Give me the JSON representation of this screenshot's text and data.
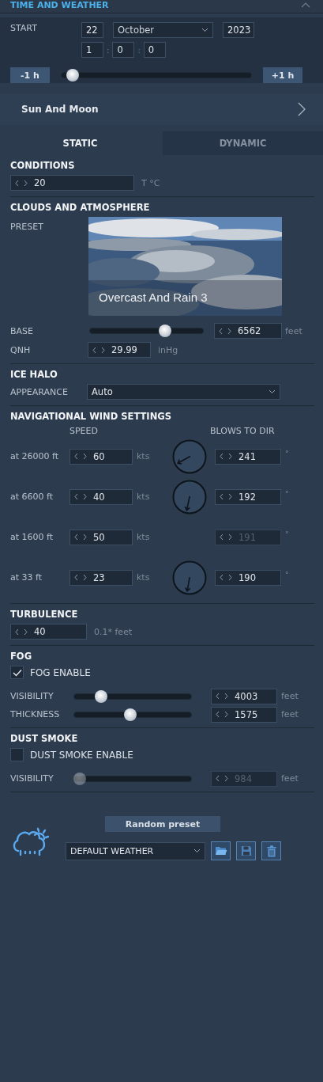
{
  "window": {
    "title": "TIME AND WEATHER"
  },
  "start": {
    "label": "START",
    "day": "22",
    "month": "October",
    "year": "2023",
    "hour": "1",
    "minute": "0",
    "second": "0",
    "separator": ":"
  },
  "time_slider": {
    "minus": "-1 h",
    "plus": "+1 h",
    "level": 0.03
  },
  "sun_and_moon": {
    "label": "Sun And Moon"
  },
  "tabs": [
    {
      "label": "STATIC",
      "selected": true
    },
    {
      "label": "DYNAMIC",
      "selected": false
    }
  ],
  "conditions": {
    "title": "CONDITIONS",
    "temperature": "20",
    "unit": "T °C"
  },
  "clouds": {
    "title": "CLOUDS AND ATMOSPHERE",
    "preset_label": "PRESET",
    "preset": {
      "kind": "picture",
      "caption": "Overcast And Rain 3"
    },
    "base": {
      "label": "BASE",
      "level": 0.68,
      "value": "6562",
      "unit": "feet"
    },
    "qnh": {
      "label": "QNH",
      "value": "29.99",
      "unit": "inHg"
    }
  },
  "ice_halo": {
    "title": "ICE HALO",
    "label": "APPEARANCE",
    "value": "Auto"
  },
  "wind": {
    "title": "NAVIGATIONAL WIND SETTINGS",
    "speed_header": "SPEED",
    "dir_header": "BLOWS TO DIR",
    "rows": [
      {
        "altitude": "at 26000 ft",
        "speed": "60",
        "speed_unit": "kts",
        "direction": "241",
        "direction_unit": "°",
        "disabled": false
      },
      {
        "altitude": "at 6600 ft",
        "speed": "40",
        "speed_unit": "kts",
        "direction": "192",
        "direction_unit": "°",
        "disabled": false
      },
      {
        "altitude": "at 1600 ft",
        "speed": "50",
        "speed_unit": "kts",
        "direction": "191",
        "direction_unit": "°",
        "disabled": true
      },
      {
        "altitude": "at 33 ft",
        "speed": "23",
        "speed_unit": "kts",
        "direction": "190",
        "direction_unit": "°",
        "disabled": false
      }
    ]
  },
  "turbulence": {
    "title": "TURBULENCE",
    "value": "40",
    "unit": "0.1* feet"
  },
  "fog": {
    "title": "FOG",
    "enable": {
      "label": "FOG ENABLE",
      "checked": true
    },
    "rows": [
      {
        "label": "VISIBILITY",
        "level": 0.2,
        "value": "4003",
        "unit": "feet",
        "disabled": false
      },
      {
        "label": "THICKNESS",
        "level": 0.48,
        "value": "1575",
        "unit": "feet",
        "disabled": false
      }
    ]
  },
  "dust_smoke": {
    "title": "DUST SMOKE",
    "enable": {
      "label": "DUST SMOKE ENABLE",
      "checked": false
    },
    "rows": [
      {
        "label": "VISIBILITY",
        "level": 0,
        "value": "984",
        "unit": "feet",
        "disabled": true
      }
    ]
  },
  "footer": {
    "random_button": "Random preset",
    "preset": "DEFAULT WEATHER"
  }
}
